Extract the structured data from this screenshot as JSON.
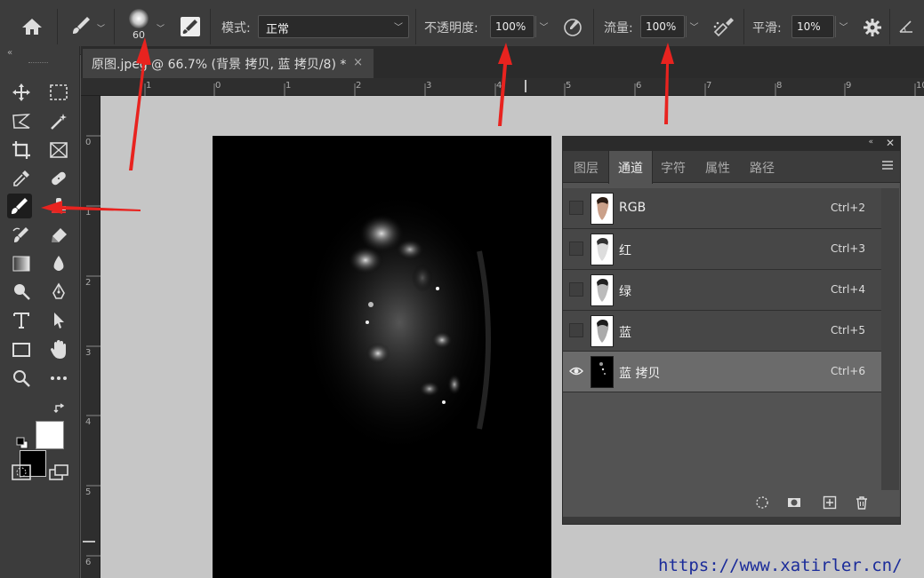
{
  "options_bar": {
    "brush_size": "60",
    "mode_label": "模式:",
    "mode_value": "正常",
    "opacity_label": "不透明度:",
    "opacity_value": "100%",
    "flow_label": "流量:",
    "flow_value": "100%",
    "smoothing_label": "平滑:",
    "smoothing_value": "10%",
    "icons": [
      "home-icon",
      "brush-icon",
      "toggle-brush-panel-icon",
      "pressure-opacity-icon",
      "airbrush-icon",
      "gear-icon",
      "angle-icon"
    ]
  },
  "document_tab": {
    "title": "原图.jpeg @ 66.7% (背景 拷贝, 蓝 拷贝/8) *",
    "close": "×"
  },
  "ruler": {
    "horizontal": [
      "1",
      "0",
      "1",
      "2",
      "3",
      "4",
      "5",
      "6",
      "7",
      "8",
      "9",
      "10"
    ],
    "vertical": [
      "0",
      "1",
      "2",
      "3",
      "4",
      "5",
      "6"
    ]
  },
  "panel": {
    "tabs": [
      "图层",
      "通道",
      "字符",
      "属性",
      "路径"
    ],
    "active_tab": "通道",
    "channels": [
      {
        "name": "RGB",
        "shortcut": "Ctrl+2",
        "visible": false,
        "selected": false
      },
      {
        "name": "红",
        "shortcut": "Ctrl+3",
        "visible": false,
        "selected": false
      },
      {
        "name": "绿",
        "shortcut": "Ctrl+4",
        "visible": false,
        "selected": false
      },
      {
        "name": "蓝",
        "shortcut": "Ctrl+5",
        "visible": false,
        "selected": false
      },
      {
        "name": "蓝 拷贝",
        "shortcut": "Ctrl+6",
        "visible": true,
        "selected": true
      }
    ],
    "bottom_icons": [
      "load-selection-icon",
      "save-selection-icon",
      "new-channel-icon",
      "delete-channel-icon"
    ]
  },
  "toolbar": {
    "tools": [
      "move-tool",
      "marquee-tool",
      "lasso-tool",
      "magic-wand-tool",
      "crop-tool",
      "frame-tool",
      "eyedropper-tool",
      "healing-tool",
      "brush-tool",
      "clone-stamp-tool",
      "history-brush-tool",
      "eraser-tool",
      "gradient-tool",
      "blur-tool",
      "dodge-tool",
      "pen-tool",
      "type-tool",
      "path-select-tool",
      "rectangle-tool",
      "hand-tool",
      "zoom-tool",
      "more-tools"
    ],
    "foreground": "#000000",
    "background": "#ffffff"
  },
  "colors": {
    "arrow": "#e8231f",
    "canvas_bg": "#c6c6c6",
    "panel_bg": "#535353"
  },
  "watermark": "https://www.xatirler.cn/"
}
